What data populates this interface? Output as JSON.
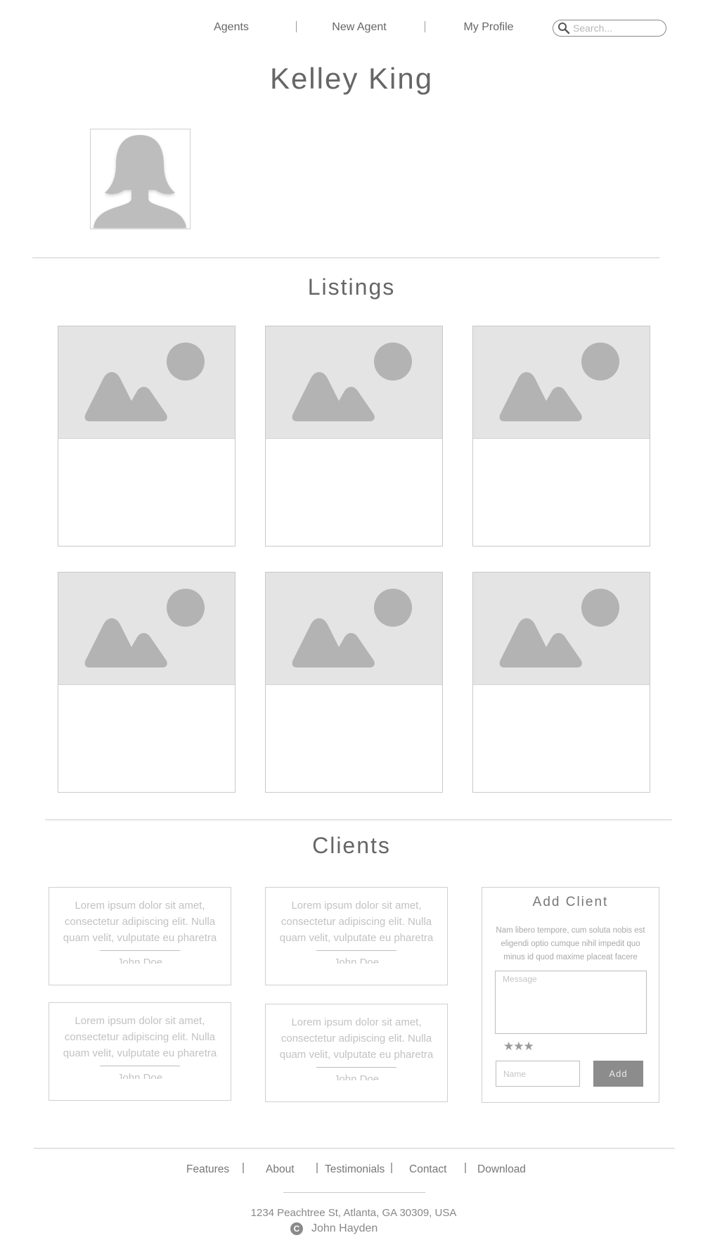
{
  "nav": {
    "links": [
      "Agents",
      "New Agent",
      "My Profile"
    ],
    "search_placeholder": "Search..."
  },
  "profile": {
    "name": "Kelley King"
  },
  "listings": {
    "title": "Listings",
    "count": 6
  },
  "clients": {
    "title": "Clients",
    "testimonials": [
      {
        "quote": "Lorem ipsum dolor sit amet, consectetur adipiscing elit. Nulla quam velit, vulputate eu pharetra",
        "author": "John Doe"
      },
      {
        "quote": "Lorem ipsum dolor sit amet, consectetur adipiscing elit. Nulla quam velit, vulputate eu pharetra",
        "author": "John Doe"
      },
      {
        "quote": "Lorem ipsum dolor sit amet, consectetur adipiscing elit. Nulla quam velit, vulputate eu pharetra",
        "author": "John Doe"
      },
      {
        "quote": "Lorem ipsum dolor sit amet, consectetur adipiscing elit. Nulla quam velit, vulputate eu pharetra",
        "author": "John Doe"
      }
    ],
    "add_form": {
      "title": "Add Client",
      "description": "Nam libero tempore, cum soluta nobis est eligendi optio cumque nihil impedit quo minus id quod maxime placeat facere",
      "message_placeholder": "Message",
      "rating_stars": "★★★",
      "rating": 3,
      "name_placeholder": "Name",
      "button_label": "Add"
    }
  },
  "footer": {
    "links": [
      "Features",
      "About",
      "Testimonials",
      "Contact",
      "Download"
    ],
    "address": "1234 Peachtree St, Atlanta, GA 30309, USA",
    "copyright_symbol": "C",
    "copyright_name": "John Hayden"
  }
}
